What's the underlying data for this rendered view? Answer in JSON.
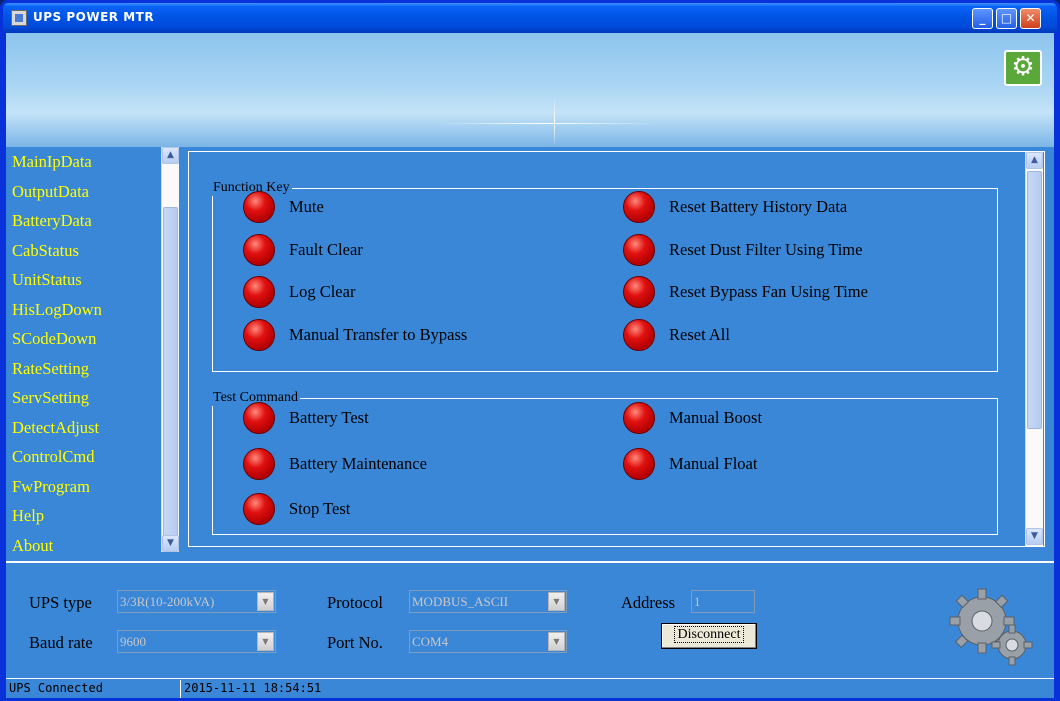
{
  "window": {
    "title": "UPS POWER MTR",
    "minimize_glyph": "_",
    "maximize_glyph": "□",
    "close_glyph": "✕"
  },
  "banner": {
    "settings_icon": "gear-icon"
  },
  "sidebar": {
    "items": [
      {
        "label": "MainIpData"
      },
      {
        "label": "OutputData"
      },
      {
        "label": "BatteryData"
      },
      {
        "label": "CabStatus"
      },
      {
        "label": "UnitStatus"
      },
      {
        "label": "HisLogDown"
      },
      {
        "label": "SCodeDown"
      },
      {
        "label": "RateSetting"
      },
      {
        "label": "ServSetting"
      },
      {
        "label": "DetectAdjust"
      },
      {
        "label": "ControlCmd"
      },
      {
        "label": "FwProgram"
      },
      {
        "label": "Help"
      },
      {
        "label": "About"
      }
    ]
  },
  "function_key": {
    "legend": "Function Key",
    "left": [
      {
        "label": "Mute"
      },
      {
        "label": "Fault Clear"
      },
      {
        "label": "Log Clear"
      },
      {
        "label": "Manual Transfer to Bypass"
      }
    ],
    "right": [
      {
        "label": "Reset Battery History Data"
      },
      {
        "label": "Reset Dust Filter Using Time"
      },
      {
        "label": "Reset Bypass Fan Using Time"
      },
      {
        "label": "Reset All"
      }
    ]
  },
  "test_command": {
    "legend": "Test Command",
    "left": [
      {
        "label": "Battery Test"
      },
      {
        "label": "Battery Maintenance"
      },
      {
        "label": "Stop Test"
      }
    ],
    "right": [
      {
        "label": "Manual Boost"
      },
      {
        "label": "Manual Float"
      }
    ]
  },
  "connection": {
    "ups_type_label": "UPS type",
    "ups_type_value": "3/3R(10-200kVA)",
    "protocol_label": "Protocol",
    "protocol_value": "MODBUS_ASCII",
    "address_label": "Address",
    "address_value": "1",
    "baud_rate_label": "Baud rate",
    "baud_rate_value": "9600",
    "port_label": "Port No.",
    "port_value": "COM4",
    "disconnect_label": "Disconnect"
  },
  "status": {
    "connection": "UPS Connected",
    "datetime": "2015-11-11 18:54:51"
  },
  "colors": {
    "panel_blue": "#3a87d8",
    "nav_text": "#ffff00",
    "led_red": "#e01010",
    "title_blue": "#0055e5"
  }
}
